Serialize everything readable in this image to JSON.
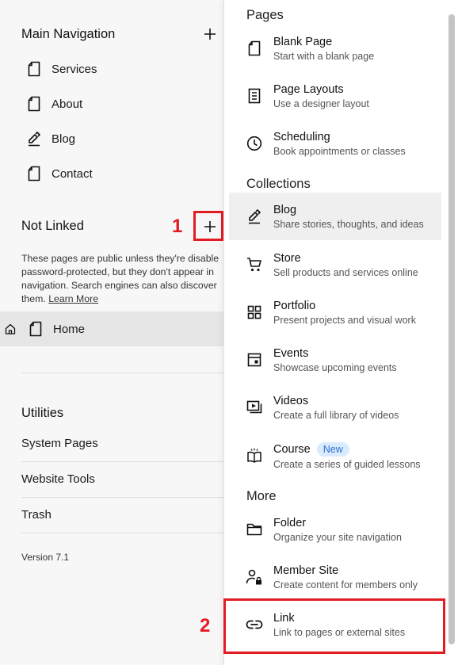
{
  "sidebar": {
    "main_nav_title": "Main Navigation",
    "main_nav_items": [
      {
        "label": "Services",
        "icon": "page-icon"
      },
      {
        "label": "About",
        "icon": "page-icon"
      },
      {
        "label": "Blog",
        "icon": "blog-icon"
      },
      {
        "label": "Contact",
        "icon": "page-icon"
      }
    ],
    "not_linked_title": "Not Linked",
    "not_linked_description_lines": [
      "These pages are public unless they're disable",
      "password-protected, but they don't appear in",
      "navigation. Search engines can also discover"
    ],
    "not_linked_description_last": "them.",
    "learn_more": "Learn More",
    "home_item": {
      "label": "Home"
    },
    "utilities_title": "Utilities",
    "utilities_items": [
      "System Pages",
      "Website Tools",
      "Trash"
    ],
    "version": "Version 7.1"
  },
  "annotations": {
    "step1": "1",
    "step2": "2",
    "color": "#e31b23"
  },
  "menu": {
    "groups": [
      {
        "title": "Pages",
        "items": [
          {
            "title": "Blank Page",
            "subtitle": "Start with a blank page",
            "icon": "blank-page-icon"
          },
          {
            "title": "Page Layouts",
            "subtitle": "Use a designer layout",
            "icon": "layout-icon"
          },
          {
            "title": "Scheduling",
            "subtitle": "Book appointments or classes",
            "icon": "clock-icon"
          }
        ]
      },
      {
        "title": "Collections",
        "items": [
          {
            "title": "Blog",
            "subtitle": "Share stories, thoughts, and ideas",
            "icon": "blog-icon"
          },
          {
            "title": "Store",
            "subtitle": "Sell products and services online",
            "icon": "cart-icon"
          },
          {
            "title": "Portfolio",
            "subtitle": "Present projects and visual work",
            "icon": "grid-icon"
          },
          {
            "title": "Events",
            "subtitle": "Showcase upcoming events",
            "icon": "calendar-icon"
          },
          {
            "title": "Videos",
            "subtitle": "Create a full library of videos",
            "icon": "video-icon"
          },
          {
            "title": "Course",
            "subtitle": "Create a series of guided lessons",
            "icon": "book-icon",
            "badge": "New"
          }
        ]
      },
      {
        "title": "More",
        "items": [
          {
            "title": "Folder",
            "subtitle": "Organize your site navigation",
            "icon": "folder-icon"
          },
          {
            "title": "Member Site",
            "subtitle": "Create content for members only",
            "icon": "member-icon"
          },
          {
            "title": "Link",
            "subtitle": "Link to pages or external sites",
            "icon": "link-icon"
          }
        ]
      }
    ]
  }
}
